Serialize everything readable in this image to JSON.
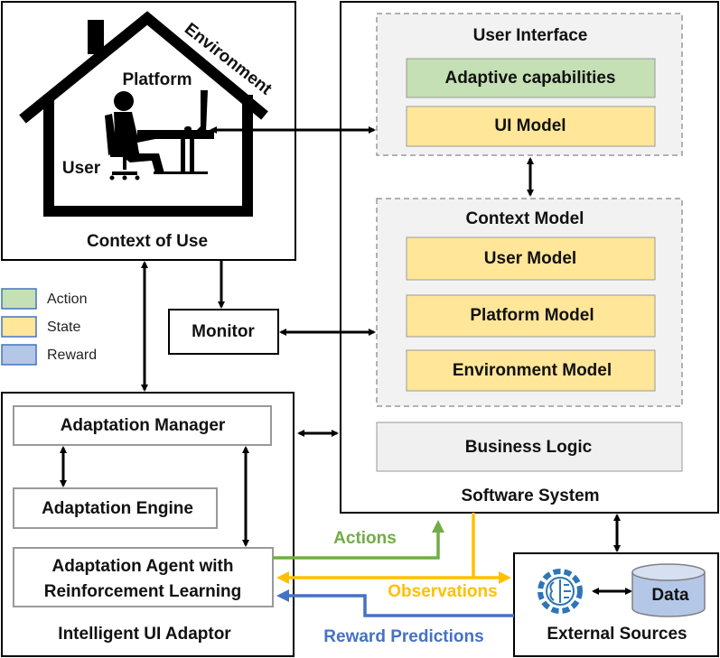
{
  "context_of_use": {
    "title": "Context of Use",
    "environment": "Environment",
    "platform": "Platform",
    "user": "User"
  },
  "legend": [
    {
      "label": "Action",
      "color": "#c5e0b4"
    },
    {
      "label": "State",
      "color": "#ffe699"
    },
    {
      "label": "Reward",
      "color": "#b4c7e7"
    }
  ],
  "monitor": "Monitor",
  "software_system": {
    "title": "Software System",
    "user_interface": {
      "title": "User Interface",
      "items": [
        "Adaptive capabilities",
        "UI Model"
      ]
    },
    "context_model": {
      "title": "Context Model",
      "items": [
        "User Model",
        "Platform Model",
        "Environment Model"
      ]
    },
    "business_logic": "Business Logic"
  },
  "adaptor": {
    "title": "Intelligent UI Adaptor",
    "manager": "Adaptation Manager",
    "engine": "Adaptation Engine",
    "agent_line1": "Adaptation Agent with",
    "agent_line2": "Reinforcement Learning"
  },
  "external": {
    "title": "External Sources",
    "data": "Data",
    "icon": "ai-gear-icon"
  },
  "flows": {
    "actions": "Actions",
    "observations": "Observations",
    "rewards": "Reward Predictions"
  },
  "colors": {
    "action": "#70ad47",
    "observation": "#ffc000",
    "reward": "#4472c4",
    "green_fill": "#c5e0b4",
    "yellow_fill": "#ffe699",
    "gray_fill": "#f0f0f0"
  }
}
